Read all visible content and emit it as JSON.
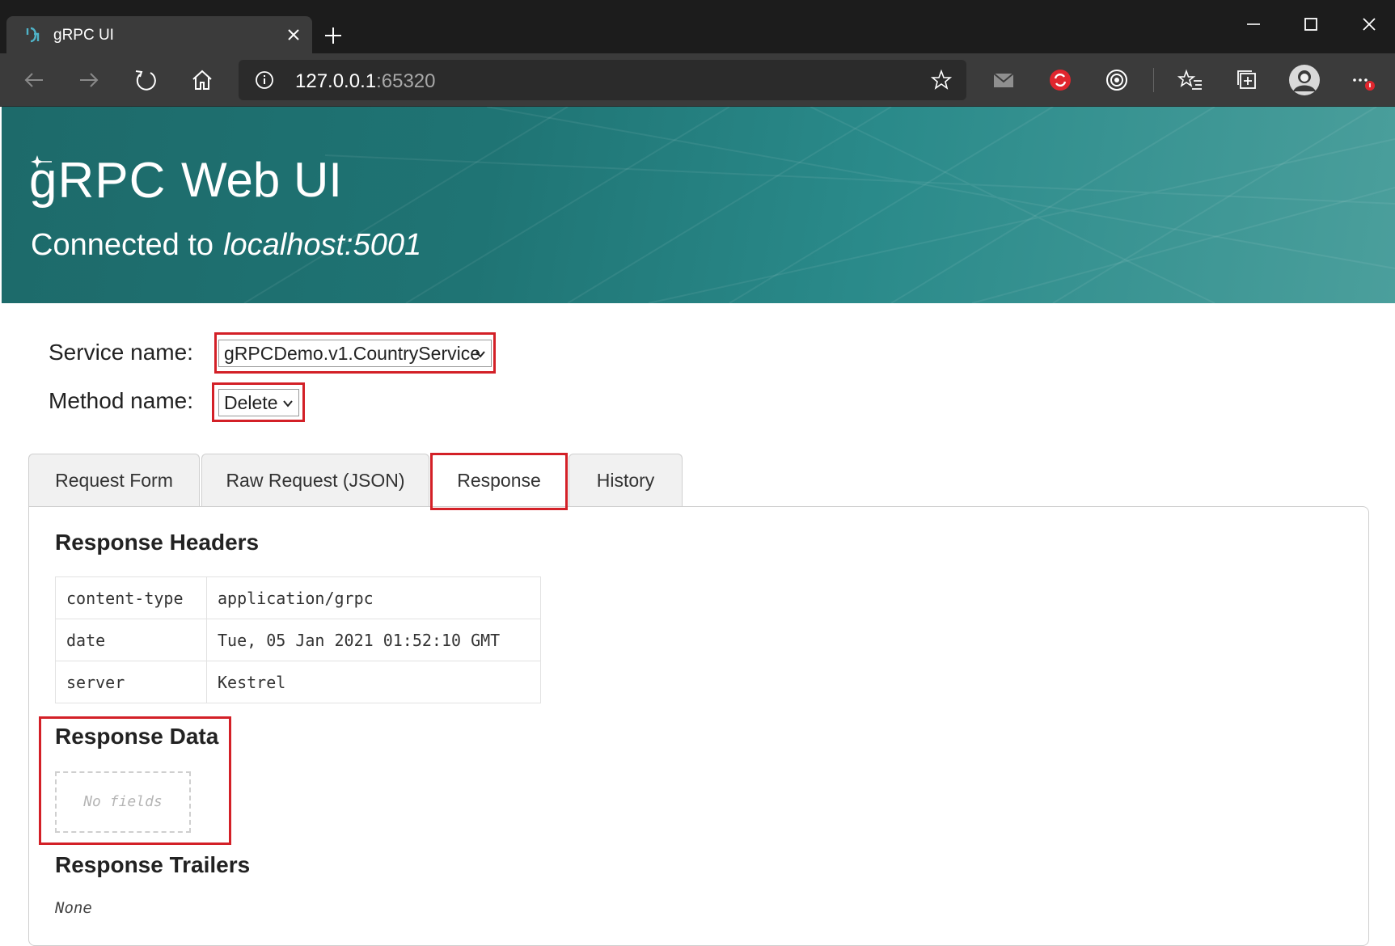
{
  "browser": {
    "tab_title": "gRPC UI",
    "url_host": "127.0.0.1",
    "url_port": ":65320"
  },
  "banner": {
    "logo_text": "gRPC",
    "title": "Web UI",
    "connected_label": "Connected to",
    "connected_host": "localhost:5001"
  },
  "form": {
    "service_label": "Service name:",
    "service_value": "gRPCDemo.v1.CountryService",
    "method_label": "Method name:",
    "method_value": "Delete"
  },
  "tabs": [
    {
      "label": "Request Form"
    },
    {
      "label": "Raw Request (JSON)"
    },
    {
      "label": "Response"
    },
    {
      "label": "History"
    }
  ],
  "active_tab": "Response",
  "response": {
    "headers_title": "Response Headers",
    "headers": [
      {
        "key": "content-type",
        "value": "application/grpc"
      },
      {
        "key": "date",
        "value": "Tue, 05 Jan 2021 01:52:10 GMT"
      },
      {
        "key": "server",
        "value": "Kestrel"
      }
    ],
    "data_title": "Response Data",
    "data_empty": "No fields",
    "trailers_title": "Response Trailers",
    "trailers_value": "None"
  },
  "colors": {
    "highlight": "#d32027",
    "banner": "#1f7474",
    "chrome_dark": "#1c1c1c",
    "chrome_toolbar": "#3b3b3b"
  },
  "icons": [
    "grpc-favicon-icon",
    "close-icon",
    "plus-icon",
    "minimize-icon",
    "maximize-icon",
    "back-icon",
    "forward-icon",
    "refresh-icon",
    "home-icon",
    "info-icon",
    "star-icon",
    "mail-icon",
    "sync-extension-icon",
    "target-extension-icon",
    "favorites-icon",
    "collections-icon",
    "profile-avatar-icon",
    "more-icon"
  ]
}
